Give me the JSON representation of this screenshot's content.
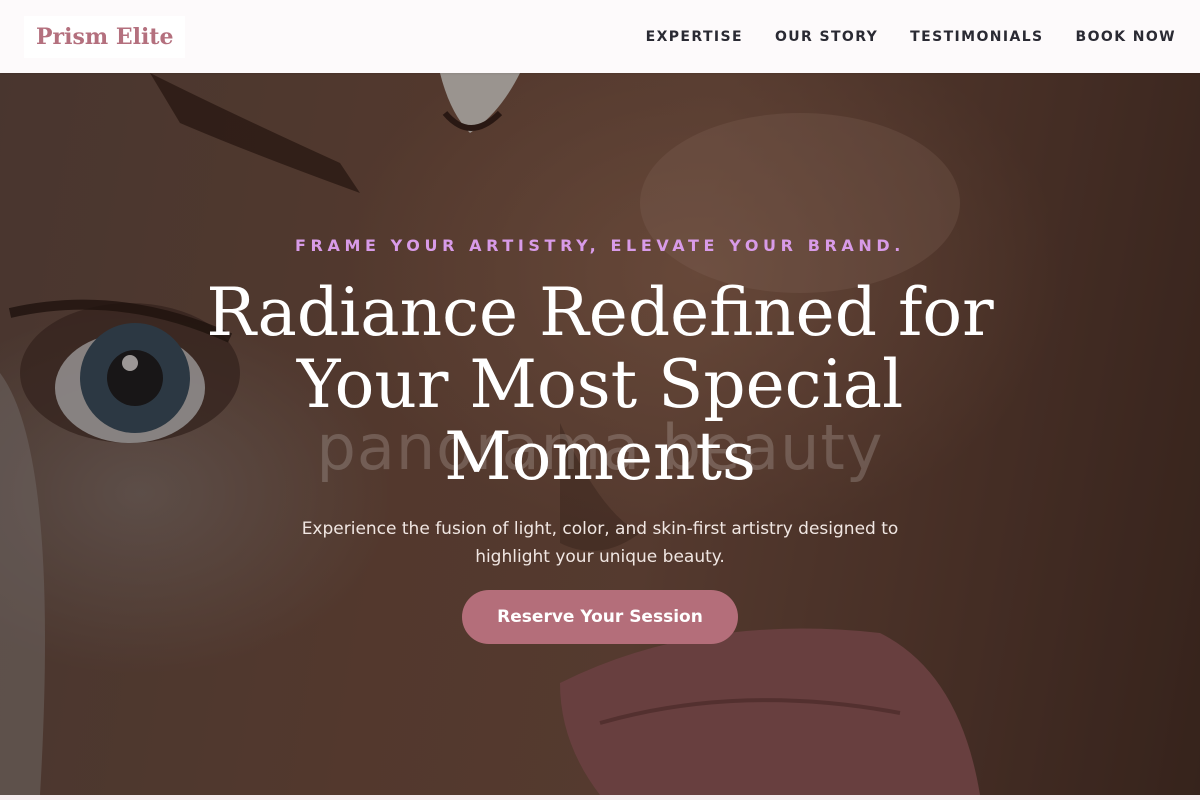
{
  "header": {
    "logo": "Prism Elite",
    "nav": [
      "EXPERTISE",
      "OUR STORY",
      "TESTIMONIALS",
      "BOOK NOW"
    ]
  },
  "hero": {
    "tagline": "FRAME YOUR ARTISTRY, ELEVATE YOUR BRAND.",
    "headline": "Radiance Redefined for Your Most Special Moments",
    "subtext": "Experience the fusion of light, color, and skin-first artistry designed to highlight your unique beauty.",
    "cta_label": "Reserve Your Session",
    "watermark": "panorama beauty"
  },
  "colors": {
    "brand": "#b4707e",
    "accent_tagline": "#d89be8",
    "cta_background": "#b46e7a",
    "header_background": "#fdfafb"
  }
}
